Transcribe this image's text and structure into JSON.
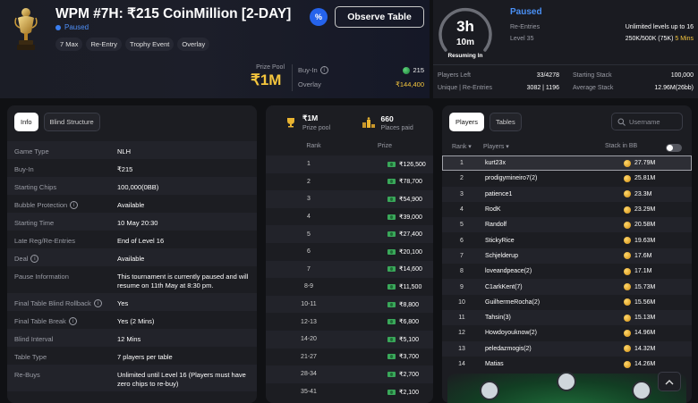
{
  "header": {
    "title": "WPM #7H: ₹215 CoinMillion [2-DAY]",
    "status": "Paused",
    "tags": [
      "7 Max",
      "Re-Entry",
      "Trophy Event",
      "Overlay"
    ],
    "promo_badge": "%",
    "observe_label": "Observe Table",
    "prize_pool_label": "Prize Pool",
    "prize_pool_value": "₹1M",
    "buyin_label": "Buy-In",
    "buyin_value": "215",
    "overlay_label": "Overlay",
    "overlay_value": "₹144,400"
  },
  "timer": {
    "hours": "3h",
    "minutes": "10m",
    "caption": "Resuming In",
    "status": "Paused",
    "reentries_label": "Re-Entries",
    "reentries_value": "Unlimited levels up to 16",
    "level_label": "Level 35",
    "level_value": "250K/500K (75K)",
    "level_time": "5 Mins"
  },
  "stats": {
    "players_left_label": "Players Left",
    "players_left_value": "33/4278",
    "unique_label": "Unique | Re-Entries",
    "unique_value": "3082 | 1196",
    "starting_stack_label": "Starting Stack",
    "starting_stack_value": "100,000",
    "average_stack_label": "Average Stack",
    "average_stack_value": "12.96M(26bb)"
  },
  "info": {
    "tabs": [
      "Info",
      "Blind Structure"
    ],
    "rows": [
      {
        "key": "Game Type",
        "value": "NLH",
        "info": false
      },
      {
        "key": "Buy-In",
        "value": "₹215",
        "info": false
      },
      {
        "key": "Starting Chips",
        "value": "100,000(0BB)",
        "info": false
      },
      {
        "key": "Bubble Protection",
        "value": "Available",
        "info": true
      },
      {
        "key": "Starting Time",
        "value": "10 May 20:30",
        "info": false
      },
      {
        "key": "Late Reg/Re-Entries",
        "value": "End of Level 16",
        "info": false
      },
      {
        "key": "Deal",
        "value": "Available",
        "info": true
      },
      {
        "key": "Pause Information",
        "value": "This tournament is currently paused and will resume on 11th May at 8:30 pm.",
        "info": false
      },
      {
        "key": "Final Table Blind Rollback",
        "value": "Yes",
        "info": true
      },
      {
        "key": "Final Table Break",
        "value": "Yes (2 Mins)",
        "info": true
      },
      {
        "key": "Blind Interval",
        "value": "12 Mins",
        "info": false
      },
      {
        "key": "Table Type",
        "value": "7 players per table",
        "info": false
      },
      {
        "key": "Re-Buys",
        "value": "Unlimited until Level 16 (Players must have zero chips to re-buy)",
        "info": false
      }
    ]
  },
  "prizes": {
    "pool_value": "₹1M",
    "pool_label": "Prize pool",
    "paid_value": "660",
    "paid_label": "Places paid",
    "col_rank": "Rank",
    "col_prize": "Prize",
    "rows": [
      {
        "rank": "1",
        "prize": "₹126,500"
      },
      {
        "rank": "2",
        "prize": "₹78,700"
      },
      {
        "rank": "3",
        "prize": "₹54,900"
      },
      {
        "rank": "4",
        "prize": "₹39,000"
      },
      {
        "rank": "5",
        "prize": "₹27,400"
      },
      {
        "rank": "6",
        "prize": "₹20,100"
      },
      {
        "rank": "7",
        "prize": "₹14,600"
      },
      {
        "rank": "8-9",
        "prize": "₹11,500"
      },
      {
        "rank": "10-11",
        "prize": "₹8,800"
      },
      {
        "rank": "12-13",
        "prize": "₹6,800"
      },
      {
        "rank": "14-20",
        "prize": "₹5,100"
      },
      {
        "rank": "21-27",
        "prize": "₹3,700"
      },
      {
        "rank": "28-34",
        "prize": "₹2,700"
      },
      {
        "rank": "35-41",
        "prize": "₹2,100"
      }
    ]
  },
  "players": {
    "tabs": [
      "Players",
      "Tables"
    ],
    "search_placeholder": "Username",
    "col_rank": "Rank",
    "col_players": "Players",
    "col_stack": "Stack in BB",
    "rows": [
      {
        "rank": "1",
        "name": "kurt23x",
        "stack": "27.79M"
      },
      {
        "rank": "2",
        "name": "prodigymineiro7(2)",
        "stack": "25.81M"
      },
      {
        "rank": "3",
        "name": "patience1",
        "stack": "23.3M"
      },
      {
        "rank": "4",
        "name": "RodK",
        "stack": "23.29M"
      },
      {
        "rank": "5",
        "name": "Randolf",
        "stack": "20.58M"
      },
      {
        "rank": "6",
        "name": "StickyRice",
        "stack": "19.63M"
      },
      {
        "rank": "7",
        "name": "Schjelderup",
        "stack": "17.6M"
      },
      {
        "rank": "8",
        "name": "loveandpeace(2)",
        "stack": "17.1M"
      },
      {
        "rank": "9",
        "name": "C1arkKent(7)",
        "stack": "15.73M"
      },
      {
        "rank": "10",
        "name": "GuilhermeRocha(2)",
        "stack": "15.56M"
      },
      {
        "rank": "11",
        "name": "Tahsin(3)",
        "stack": "15.13M"
      },
      {
        "rank": "12",
        "name": "Howdoyouknow(2)",
        "stack": "14.96M"
      },
      {
        "rank": "13",
        "name": "peledazmogis(2)",
        "stack": "14.32M"
      },
      {
        "rank": "14",
        "name": "Matias",
        "stack": "14.26M"
      }
    ]
  },
  "colors": {
    "accent_blue": "#4a90f5",
    "gold": "#f4c53d",
    "background": "#101114",
    "panel": "#1c1d22"
  },
  "icons": [
    "trophy-icon",
    "info-icon",
    "coin-icon",
    "cash-icon",
    "podium-icon",
    "search-icon",
    "chevron-up-icon",
    "sort-icon"
  ]
}
